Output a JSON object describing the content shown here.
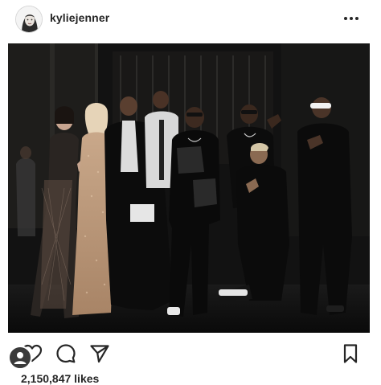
{
  "header": {
    "username": "kyliejenner",
    "avatar_icon": "profile-avatar-icon",
    "more_icon": "more-options-icon"
  },
  "photo": {
    "icon": "photo-image"
  },
  "actions": {
    "like_icon": "heart-icon",
    "comment_icon": "comment-icon",
    "share_icon": "paper-plane-icon",
    "save_icon": "bookmark-icon",
    "owner_icon": "user-badge-icon"
  },
  "likes": {
    "text": "2,150,847 likes"
  },
  "colors": {
    "text": "#262626",
    "photo_bg": "#0f0f0f"
  }
}
